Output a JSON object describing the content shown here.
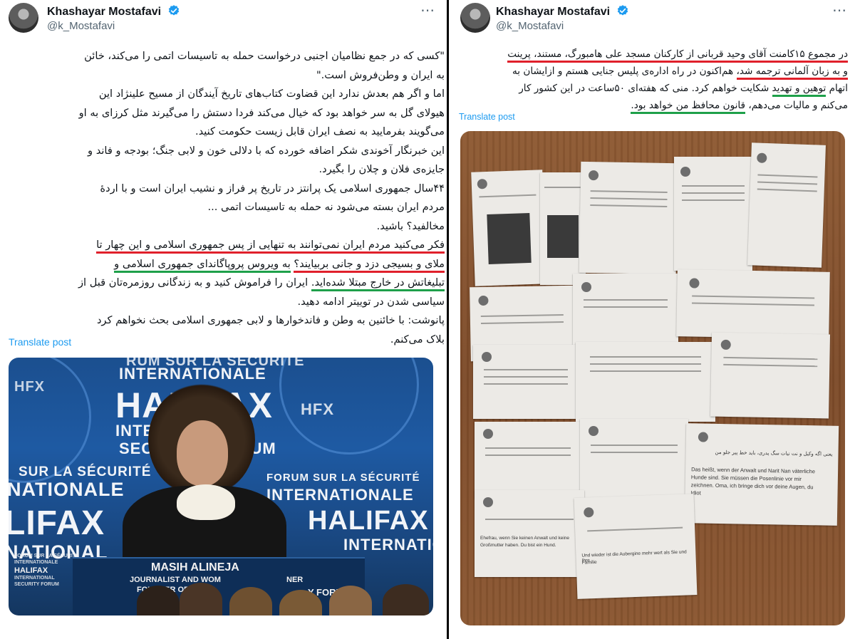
{
  "left_post": {
    "author_name": "Khashayar Mostafavi",
    "handle": "@k_Mostafavi",
    "more_icon": "⋯",
    "body_lines": [
      "\"کسی که در جمع نظامیان اجنبی درخواست حمله به تاسیسات اتمی را می‌کند، خائن",
      "به ایران و وطن‌فروش است.\"",
      "اما و اگر هم بعدش ندارد این قضاوت کتاب‌های تاریخ آیندگان از مسیح علینژاد این",
      "هیولای گل به سر خواهد بود که خیال می‌کند فردا دستش را می‌گیرند مثل کرزای به او",
      "می‌گویند بفرمایید به نصف ایران قابل زیست حکومت کنید.",
      "این خبرنگار آخوندی شکر اضافه خورده که با دلالی خون و لابی جنگ؛ بودجه و فاند و",
      "جایزه‌ی فلان و چلان را بگیرد.",
      "۴۴سال جمهوری اسلامی یک پرانتز در تاریخ پر فراز و نشیب ایران است و با اردهٔ",
      "مردم ایران بسته می‌شود نه حمله به تاسیسات اتمی ...",
      "مخالفید؟ باشید."
    ],
    "highlight_line_1": "فکر می‌کنید مردم ایران نمی‌توانند به تنهایی از پس جمهوری اسلامی و این چهار تا",
    "highlight_line_2_red": "ملای و بسیجی دزد و جانی بربیایند؟",
    "highlight_line_2_green": "به ویروس پروپاگاندای جمهوری اسلامی و",
    "highlight_line_3_green": "تبلیغاتش در خارج مبتلا شده‌اید.",
    "highlight_line_3_rest": " ایران را فراموش کنید و به زندگانی روزمره‌تان قبل از",
    "after_lines": [
      "سیاسی شدن در توییتر ادامه دهید.",
      "پانوشت: با خائنین به وطن و فاندخوارها و لابی جمهوری اسلامی بحث نخواهم کرد",
      "بلاک می‌کنم."
    ],
    "translate_label": "Translate post",
    "photo": {
      "banner_line_1": "RUM SUR LA SÉCURITÉ",
      "banner_line_2": "INTERNATIONALE",
      "logo_text": "HALIFAX",
      "partial_inter": "INTER",
      "partial_secu": "SECU",
      "partial_forum": "FORUM",
      "left_sur": "SUR LA SÉCURITÉ",
      "left_nationale": "NATIONALE",
      "left_lifax": "LIFAX",
      "left_national": "NATIONAL",
      "right_forum": "FORUM SUR LA SÉCURITÉ",
      "right_inter": "INTERNATIONALE",
      "right_halifax": "HALIFAX",
      "right_inter2": "INTERNATIONA",
      "hfx_left": "HFX",
      "hfx_right": "HFX",
      "podium_name": "MASIH ALINEJA",
      "podium_line2": "JOURNALIST AND WOM",
      "podium_line3": "FOUNDER OF",
      "corner_line1": "FORUM SUR LA SÉCURITÉ",
      "corner_line2": "INTERNATIONALE",
      "corner_line3": "HALIFAX",
      "corner_line4": "INTERNATIONAL",
      "corner_line5": "SECURITY FORUM",
      "right_bottom_forum": "Y FORUM",
      "right_bottom_ner": "NER"
    }
  },
  "right_post": {
    "author_name": "Khashayar Mostafavi",
    "handle": "@k_Mostafavi",
    "more_icon": "⋯",
    "line1_red": "در مجموع ۱۵کامنت آقای وحید قربانی از کارکنان مسجد علی هامبورگ، مستند، پرینت",
    "line2_red_a": "و به زبان آلمانی ترجمه شد،",
    "line2_rest": " هم‌اکنون در راه اداره‌ی پلیس جنایی هستم و ازایشان به",
    "line3_a": "اتهام ",
    "line3_green": "توهین و تهدید",
    "line3_rest": " شکایت خواهم کرد. منی که هفته‌ای ۵۰ساعت در این کشور کار",
    "line4_a": "می‌کنم و مالیات می‌دهم، ",
    "line4_green": "قانون محافظ من خواهد بود.",
    "translate_label": "Translate post",
    "photo": {
      "sheet_caption_de_1": "Das heißt, wenn der Anwalt und Narit Nan väterliche",
      "sheet_caption_de_2": "Hunde sind. Sie müssen die Posenlinie vor mir",
      "sheet_caption_de_3": "zeichnen. Oma, ich bringe dich vor deine Augen, du",
      "sheet_caption_de_4": "Idiot",
      "sheet_caption_fa": "یعنی اگه وکیل و نت نیات سگ پدری، باید خط پیر جلو من",
      "sheet_caption_de_5": "Und wieder ist die Aubergine mehr wert als Sie und Ihre",
      "sheet_caption_de_6": "Familie",
      "sheet_caption_de_7": "Ehefrau, wenn Sie keinen Anwalt und keine",
      "sheet_caption_de_8": "Großmutter haben. Du bist ein Hund."
    }
  },
  "colors": {
    "red_underline": "#e0202b",
    "green_underline": "#1ea04a",
    "link_blue": "#1d9bf0",
    "verified_blue": "#1d9bf0",
    "muted_gray": "#536471"
  },
  "icons": {
    "verified": "verified-badge-icon",
    "more": "more-options-icon"
  }
}
